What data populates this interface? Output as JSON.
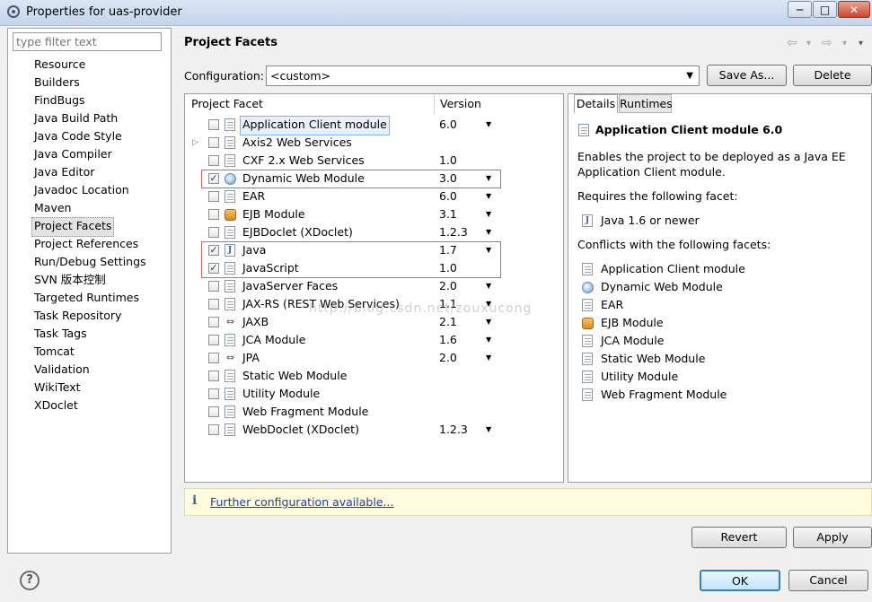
{
  "window": {
    "title": "Properties for uas-provider",
    "controls": {
      "minimize": "─",
      "maximize": "□",
      "close": "✕"
    }
  },
  "nav": {
    "filter_placeholder": "type filter text",
    "items": [
      "Resource",
      "Builders",
      "FindBugs",
      "Java Build Path",
      "Java Code Style",
      "Java Compiler",
      "Java Editor",
      "Javadoc Location",
      "Maven",
      "Project Facets",
      "Project References",
      "Run/Debug Settings",
      "SVN 版本控制",
      "Targeted Runtimes",
      "Task Repository",
      "Task Tags",
      "Tomcat",
      "Validation",
      "WikiText",
      "XDoclet"
    ],
    "selected": "Project Facets"
  },
  "header": {
    "title": "Project Facets",
    "history": {
      "back": "⇦",
      "forward": "⇨",
      "menu": "▾"
    }
  },
  "configuration": {
    "label": "Configuration:",
    "value": "<custom>",
    "save_as_label": "Save As...",
    "delete_label": "Delete"
  },
  "facets": {
    "col_facet": "Project Facet",
    "col_version": "Version",
    "rows": [
      {
        "name": "Application Client module",
        "version": "6.0",
        "checked": false,
        "dropdown": true,
        "icon": "page-icon",
        "selected": true
      },
      {
        "name": "Axis2 Web Services",
        "version": "",
        "checked": false,
        "dropdown": false,
        "icon": "page-icon",
        "expandable": true
      },
      {
        "name": "CXF 2.x Web Services",
        "version": "1.0",
        "checked": false,
        "dropdown": false,
        "icon": "page-icon"
      },
      {
        "name": "Dynamic Web Module",
        "version": "3.0",
        "checked": true,
        "dropdown": true,
        "icon": "globe-icon"
      },
      {
        "name": "EAR",
        "version": "6.0",
        "checked": false,
        "dropdown": true,
        "icon": "page-icon"
      },
      {
        "name": "EJB Module",
        "version": "3.1",
        "checked": false,
        "dropdown": true,
        "icon": "bean-icon"
      },
      {
        "name": "EJBDoclet (XDoclet)",
        "version": "1.2.3",
        "checked": false,
        "dropdown": true,
        "icon": "page-icon"
      },
      {
        "name": "Java",
        "version": "1.7",
        "checked": true,
        "dropdown": true,
        "icon": "java-icon"
      },
      {
        "name": "JavaScript",
        "version": "1.0",
        "checked": true,
        "dropdown": false,
        "icon": "page-icon"
      },
      {
        "name": "JavaServer Faces",
        "version": "2.0",
        "checked": false,
        "dropdown": true,
        "icon": "page-icon"
      },
      {
        "name": "JAX-RS (REST Web Services)",
        "version": "1.1",
        "checked": false,
        "dropdown": true,
        "icon": "page-icon"
      },
      {
        "name": "JAXB",
        "version": "2.1",
        "checked": false,
        "dropdown": true,
        "icon": "connector-icon"
      },
      {
        "name": "JCA Module",
        "version": "1.6",
        "checked": false,
        "dropdown": true,
        "icon": "page-icon"
      },
      {
        "name": "JPA",
        "version": "2.0",
        "checked": false,
        "dropdown": true,
        "icon": "connector-icon"
      },
      {
        "name": "Static Web Module",
        "version": "",
        "checked": false,
        "dropdown": false,
        "icon": "page-icon"
      },
      {
        "name": "Utility Module",
        "version": "",
        "checked": false,
        "dropdown": false,
        "icon": "page-icon"
      },
      {
        "name": "Web Fragment Module",
        "version": "",
        "checked": false,
        "dropdown": false,
        "icon": "page-icon"
      },
      {
        "name": "WebDoclet (XDoclet)",
        "version": "1.2.3",
        "checked": false,
        "dropdown": true,
        "icon": "page-icon"
      }
    ]
  },
  "details": {
    "tabs": [
      "Details",
      "Runtimes"
    ],
    "heading": "Application Client module 6.0",
    "description_1": "Enables the project to be deployed as a Java EE",
    "description_2": "Application Client module.",
    "requires_label": "Requires the following facet:",
    "requires": [
      {
        "name": "Java 1.6 or newer",
        "icon": "java-icon"
      }
    ],
    "conflicts_label": "Conflicts with the following facets:",
    "conflicts": [
      {
        "name": "Application Client module",
        "icon": "page-icon"
      },
      {
        "name": "Dynamic Web Module",
        "icon": "globe-icon"
      },
      {
        "name": "EAR",
        "icon": "page-icon"
      },
      {
        "name": "EJB Module",
        "icon": "bean-icon"
      },
      {
        "name": "JCA Module",
        "icon": "page-icon"
      },
      {
        "name": "Static Web Module",
        "icon": "page-icon"
      },
      {
        "name": "Utility Module",
        "icon": "page-icon"
      },
      {
        "name": "Web Fragment Module",
        "icon": "page-icon"
      }
    ]
  },
  "infobar": {
    "icon": "i",
    "link": "Further configuration available..."
  },
  "footer": {
    "revert_label": "Revert",
    "apply_label": "Apply",
    "ok_label": "OK",
    "cancel_label": "Cancel",
    "help": "?"
  },
  "watermark": "http://blog.csdn.net/zouxucong",
  "colors": {
    "highlight_box": "#e06060",
    "link": "#1a3fa8",
    "info_bg": "#fffce0",
    "selected_row": "#e8f1fb"
  }
}
